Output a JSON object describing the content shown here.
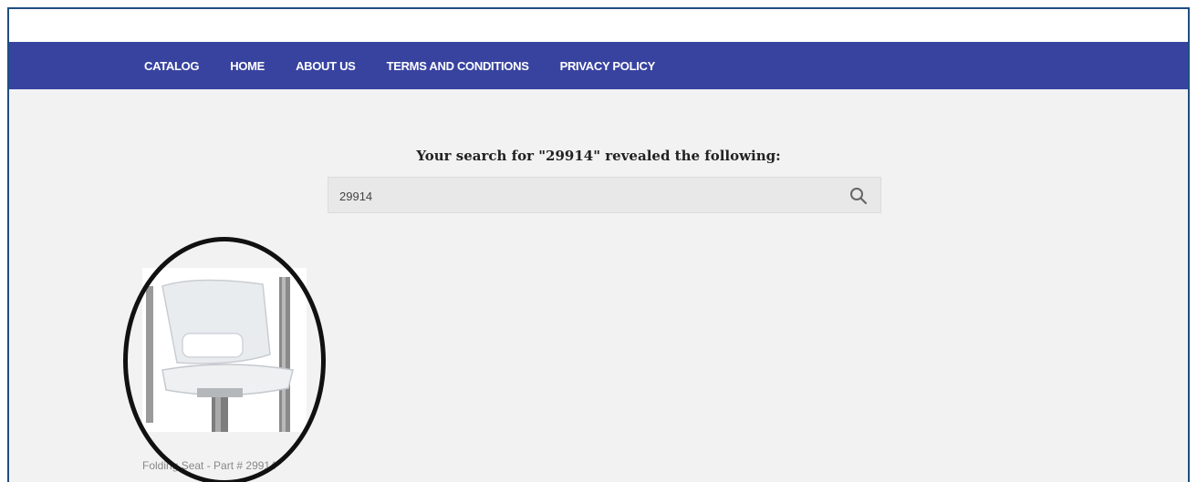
{
  "nav": {
    "items": [
      {
        "label": "CATALOG"
      },
      {
        "label": "HOME"
      },
      {
        "label": "ABOUT US"
      },
      {
        "label": "TERMS AND CONDITIONS"
      },
      {
        "label": "PRIVACY POLICY"
      }
    ]
  },
  "search": {
    "heading": "Your search for \"29914\" revealed the following:",
    "value": "29914"
  },
  "results": [
    {
      "caption": "Folding Seat - Part # 29914",
      "icon": "folding-seat-image"
    }
  ],
  "colors": {
    "nav_background": "#3843a0",
    "page_background": "#f2f2f2",
    "frame_border": "#1e4f80"
  }
}
